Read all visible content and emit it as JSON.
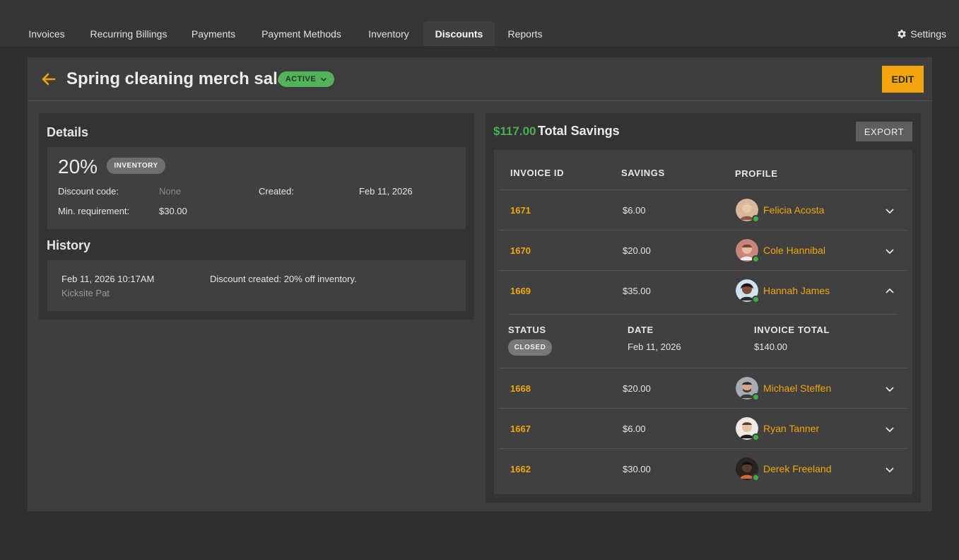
{
  "nav": {
    "tabs": [
      {
        "label": "Invoices"
      },
      {
        "label": "Recurring Billings"
      },
      {
        "label": "Payments"
      },
      {
        "label": "Payment Methods"
      },
      {
        "label": "Inventory"
      },
      {
        "label": "Discounts",
        "active": true
      },
      {
        "label": "Reports"
      }
    ],
    "settings_label": "Settings",
    "settings_icon": "gear-icon"
  },
  "header": {
    "back_icon": "arrow-left-icon",
    "title": "Spring cleaning merch sale",
    "status": "ACTIVE",
    "edit_label": "EDIT"
  },
  "details": {
    "section_title": "Details",
    "percent": "20%",
    "category_badge": "INVENTORY",
    "discount_code_label": "Discount code:",
    "discount_code_value": "None",
    "created_label": "Created:",
    "created_value": "Feb 11, 2026",
    "min_req_label": "Min. requirement:",
    "min_req_value": "$30.00"
  },
  "history": {
    "section_title": "History",
    "entries": [
      {
        "timestamp": "Feb 11, 2026 10:17AM",
        "user": "Kicksite Pat",
        "text": "Discount created: 20% off inventory."
      }
    ]
  },
  "savings": {
    "total": "$117.00",
    "total_label": "Total Savings",
    "export_label": "EXPORT",
    "columns": [
      "INVOICE ID",
      "SAVINGS",
      "PROFILE"
    ],
    "rows": [
      {
        "id": "1671",
        "savings": "$6.00",
        "name": "Felicia Acosta",
        "avatar_color": "#b8846a"
      },
      {
        "id": "1670",
        "savings": "$20.00",
        "name": "Cole Hannibal",
        "avatar_color": "#c98a7a"
      },
      {
        "id": "1669",
        "savings": "$35.00",
        "name": "Hannah James",
        "avatar_color": "#6b4a3a"
      },
      {
        "id": "1668",
        "savings": "$20.00",
        "name": "Michael Steffen",
        "avatar_color": "#8a8f96"
      },
      {
        "id": "1667",
        "savings": "$6.00",
        "name": "Ryan Tanner",
        "avatar_color": "#e5ddd2"
      },
      {
        "id": "1662",
        "savings": "$30.00",
        "name": "Derek Freeland",
        "avatar_color": "#4a3328"
      }
    ],
    "expanded": {
      "status_label": "STATUS",
      "status_value": "CLOSED",
      "date_label": "DATE",
      "date_value": "Feb 11, 2026",
      "total_label": "INVOICE TOTAL",
      "total_value": "$140.00"
    }
  },
  "colors": {
    "accent": "#f2a60c",
    "success": "#4caf50",
    "background": "#2f2f2f"
  }
}
